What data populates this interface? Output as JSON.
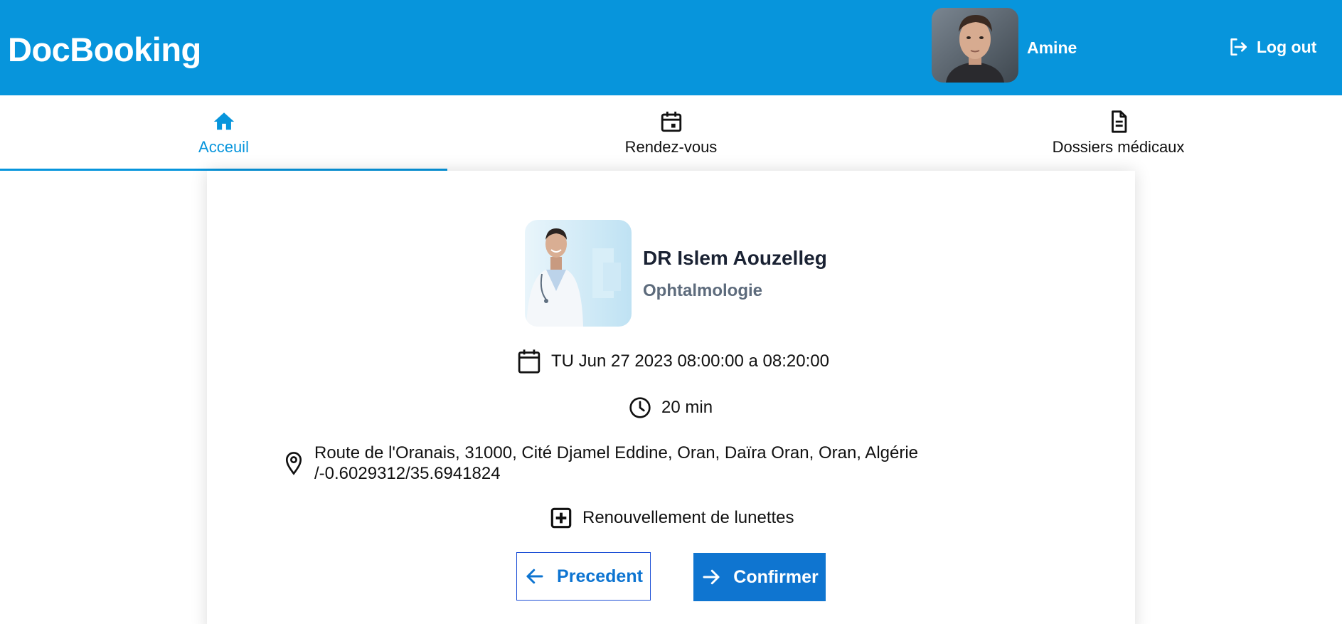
{
  "header": {
    "brand": "DocBooking",
    "user_name": "Amine",
    "logout_label": "Log out"
  },
  "tabs": [
    {
      "label": "Acceuil",
      "icon": "home-icon",
      "active": true
    },
    {
      "label": "Rendez-vous",
      "icon": "calendar-icon",
      "active": false
    },
    {
      "label": "Dossiers médicaux",
      "icon": "document-icon",
      "active": false
    }
  ],
  "doctor": {
    "name": "DR Islem Aouzelleg",
    "specialty": "Ophtalmologie"
  },
  "appointment": {
    "datetime": "TU Jun 27 2023 08:00:00 a 08:20:00",
    "duration": "20 min",
    "address_line1": "Route de l'Oranais, 31000, Cité Djamel Eddine, Oran, Daïra Oran, Oran, Algérie",
    "address_line2": "/-0.6029312/35.6941824",
    "reason": "Renouvellement de lunettes"
  },
  "actions": {
    "previous_label": "Precedent",
    "confirm_label": "Confirmer"
  },
  "colors": {
    "primary": "#0795dc",
    "button_blue": "#0f75d0",
    "doctor_name": "#1a2233",
    "specialty": "#5d6b7c"
  }
}
